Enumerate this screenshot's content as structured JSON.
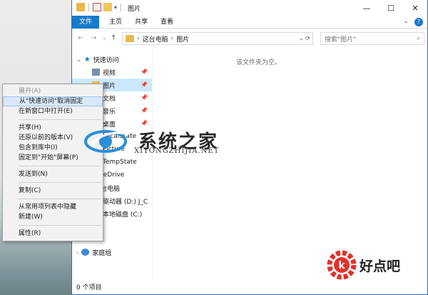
{
  "window": {
    "title": "图片",
    "controls": [
      "—",
      "☐",
      "✕"
    ]
  },
  "ribbon": {
    "tabs": [
      "文件",
      "主页",
      "共享",
      "查看"
    ],
    "expand": "⌄"
  },
  "address": {
    "crumbs": [
      "这台电脑",
      "图片"
    ],
    "search_placeholder": "搜索\"图片\""
  },
  "nav": {
    "quick_access": "快速访问",
    "items": [
      {
        "label": "视频",
        "pinned": true
      },
      {
        "label": "图片",
        "pinned": true
      },
      {
        "label": "文档",
        "pinned": true
      },
      {
        "label": "音乐",
        "pinned": true
      },
      {
        "label": "桌面",
        "pinned": true
      },
      {
        "label": "LocalState",
        "pinned": false
      },
      {
        "label": "Picture",
        "pinned": false
      },
      {
        "label": "TempState",
        "pinned": false
      }
    ],
    "onedrive": "OneDrive",
    "this_pc": "这台电脑",
    "drive_d": "驱动器 (D:) J_C",
    "drive_c": "本地磁盘 (C:)",
    "homegroup": "家庭组"
  },
  "content": {
    "empty_message": "该文件夹为空。"
  },
  "status": {
    "count": "0 个项目"
  },
  "context_menu": {
    "items": [
      {
        "label": "展开(A)",
        "disabled": true
      },
      {
        "label": "从\"快速访问\"取消固定",
        "highlight": true
      },
      {
        "label": "在新窗口中打开(E)"
      },
      {
        "sep": true
      },
      {
        "label": "共享(H)"
      },
      {
        "label": "还原以前的版本(V)"
      },
      {
        "label": "包含到库中(I)"
      },
      {
        "label": "固定到\"开始\"屏幕(P)"
      },
      {
        "sep": true
      },
      {
        "label": "发送到(N)"
      },
      {
        "sep": true
      },
      {
        "label": "复制(C)"
      },
      {
        "sep": true
      },
      {
        "label": "从常用项列表中隐藏"
      },
      {
        "label": "新建(W)"
      },
      {
        "sep": true
      },
      {
        "label": "属性(R)"
      }
    ]
  },
  "watermark": {
    "title": "系统之家",
    "sub": "XITONGZHIJIA.NET",
    "brand2": "好点吧"
  }
}
